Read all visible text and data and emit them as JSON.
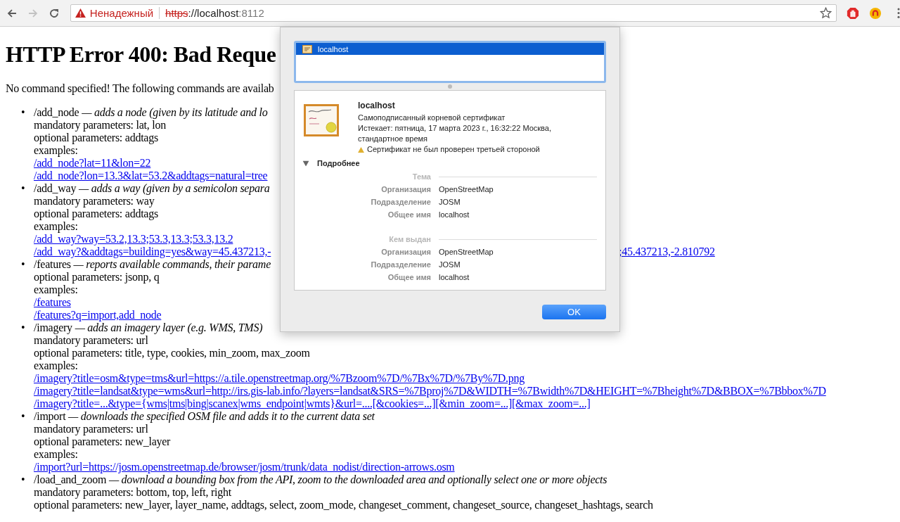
{
  "browser": {
    "security_label": "Ненадежный",
    "url_scheme": "https",
    "url_host": "://localhost",
    "url_port": ":8112"
  },
  "page": {
    "title": "HTTP Error 400: Bad Reque",
    "intro": "No command specified! The following commands are availab",
    "commands": [
      {
        "name": "/add_node",
        "bullet": "•",
        "description": "— adds a node (given by its latitude and lo",
        "lines": [
          {
            "kind": "text",
            "text": "mandatory parameters: lat, lon"
          },
          {
            "kind": "text",
            "text": "optional parameters: addtags"
          },
          {
            "kind": "text",
            "text": "examples:"
          },
          {
            "kind": "link",
            "text": "/add_node?lat=11&lon=22"
          },
          {
            "kind": "link",
            "text": "/add_node?lon=13.3&lat=53.2&addtags=natural=tree"
          }
        ]
      },
      {
        "name": "/add_way",
        "bullet": "•",
        "description": "— adds a way (given by a semicolon separa",
        "lines": [
          {
            "kind": "text",
            "text": "mandatory parameters: way"
          },
          {
            "kind": "text",
            "text": "optional parameters: addtags"
          },
          {
            "kind": "text",
            "text": "examples:"
          },
          {
            "kind": "link",
            "text": "/add_way?way=53.2,13.3;53.3,13.3;53.3,13.2"
          },
          {
            "kind": "split_link",
            "text": "/add_way?&addtags=building=yes&way=45.437213,-",
            "continuation": ";45.437213,-2.810792"
          }
        ]
      },
      {
        "name": "/features",
        "bullet": "•",
        "description": "— reports available commands, their parame",
        "lines": [
          {
            "kind": "text",
            "text": "optional parameters: jsonp, q"
          },
          {
            "kind": "text",
            "text": "examples:"
          },
          {
            "kind": "link",
            "text": "/features"
          },
          {
            "kind": "link",
            "text": "/features?q=import,add_node"
          }
        ]
      },
      {
        "name": "/imagery",
        "bullet": "•",
        "description": "— adds an imagery layer (e.g. WMS, TMS)",
        "lines": [
          {
            "kind": "text",
            "text": "mandatory parameters: url"
          },
          {
            "kind": "text",
            "text": "optional parameters: title, type, cookies, min_zoom, max_zoom"
          },
          {
            "kind": "text",
            "text": "examples:"
          },
          {
            "kind": "link",
            "text": "/imagery?title=osm&type=tms&url=https://a.tile.openstreetmap.org/%7Bzoom%7D/%7Bx%7D/%7By%7D.png"
          },
          {
            "kind": "link",
            "text": "/imagery?title=landsat&type=wms&url=http://irs.gis-lab.info/?layers=landsat&SRS=%7Bproj%7D&WIDTH=%7Bwidth%7D&HEIGHT=%7Bheight%7D&BBOX=%7Bbbox%7D"
          },
          {
            "kind": "link",
            "text": "/imagery?title=...&type={wms|tms|bing|scanex|wms_endpoint|wmts}&url=....[&cookies=...][&min_zoom=...][&max_zoom=...]"
          }
        ]
      },
      {
        "name": "/import",
        "bullet": "•",
        "description": "— downloads the specified OSM file and adds it to the current data set",
        "lines": [
          {
            "kind": "text",
            "text": "mandatory parameters: url"
          },
          {
            "kind": "text",
            "text": "optional parameters: new_layer"
          },
          {
            "kind": "text",
            "text": "examples:"
          },
          {
            "kind": "link",
            "text": "/import?url=https://josm.openstreetmap.de/browser/josm/trunk/data_nodist/direction-arrows.osm"
          }
        ]
      },
      {
        "name": "/load_and_zoom",
        "bullet": "•",
        "description": "— download a bounding box from the API, zoom to the downloaded area and optionally select one or more objects",
        "lines": [
          {
            "kind": "text",
            "text": "mandatory parameters: bottom, top, left, right"
          },
          {
            "kind": "text",
            "text": "optional parameters: new_layer, layer_name, addtags, select, zoom_mode, changeset_comment, changeset_source, changeset_hashtags, search"
          }
        ]
      }
    ]
  },
  "dialog": {
    "certificates": [
      {
        "label": "localhost",
        "selected": true
      }
    ],
    "certificate": {
      "name": "localhost",
      "type": "Самоподписанный корневой сертификат",
      "expires": "Истекает: пятница, 17 марта 2023 г., 16:32:22 Москва, стандартное время",
      "warning": "Сертификат не был проверен третьей стороной"
    },
    "details": {
      "label": "Подробнее",
      "expanded": true,
      "sections": [
        {
          "heading": "Тема",
          "rows": [
            {
              "label": "Организация",
              "value": "OpenStreetMap"
            },
            {
              "label": "Подразделение",
              "value": "JOSM"
            },
            {
              "label": "Общее имя",
              "value": "localhost"
            }
          ]
        },
        {
          "heading": "Кем выдан",
          "rows": [
            {
              "label": "Организация",
              "value": "OpenStreetMap"
            },
            {
              "label": "Подразделение",
              "value": "JOSM"
            },
            {
              "label": "Общее имя",
              "value": "localhost"
            }
          ]
        }
      ]
    },
    "button": "OK"
  }
}
